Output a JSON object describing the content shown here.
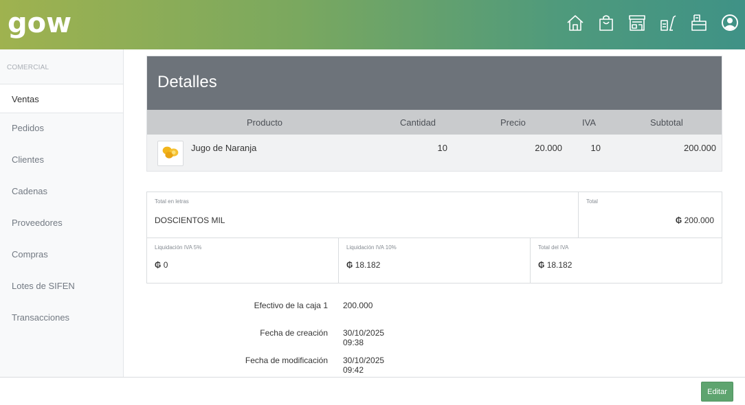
{
  "brand": {
    "logo_text": "gow"
  },
  "topbar": {
    "icons": [
      "home-icon",
      "shopping-bag-icon",
      "store-icon",
      "cart-icon",
      "inbox-icon",
      "user-icon"
    ]
  },
  "sidebar": {
    "section_title": "COMERCIAL",
    "items": [
      {
        "label": "Ventas",
        "active": true
      },
      {
        "label": "Pedidos"
      },
      {
        "label": "Clientes"
      },
      {
        "label": "Cadenas"
      },
      {
        "label": "Proveedores"
      },
      {
        "label": "Compras"
      },
      {
        "label": "Lotes de SIFEN"
      },
      {
        "label": "Transacciones"
      }
    ]
  },
  "details": {
    "title": "Detalles",
    "columns": [
      "Producto",
      "Cantidad",
      "Precio",
      "IVA",
      "Subtotal"
    ],
    "rows": [
      {
        "product": "Jugo de Naranja",
        "quantity": "10",
        "price": "20.000",
        "iva": "10",
        "subtotal": "200.000"
      }
    ]
  },
  "totals": {
    "letters_label": "Total en letras",
    "letters_value": "DOSCIENTOS MIL",
    "total_label": "Total",
    "total_value": "200.000",
    "iva5_label": "Liquidación IVA 5%",
    "iva5_value": "0",
    "iva10_label": "Liquidación IVA 10%",
    "iva10_value": "18.182",
    "iva_total_label": "Total del IVA",
    "iva_total_value": "18.182",
    "currency_symbol": "₲"
  },
  "info": [
    {
      "label": "Efectivo de la caja 1",
      "value": "200.000"
    },
    {
      "label": "Fecha de creación",
      "value": "30/10/2025 09:38"
    },
    {
      "label": "Fecha de modificación",
      "value": "30/10/2025 09:42"
    }
  ],
  "footer": {
    "edit_label": "Editar"
  },
  "colors": {
    "accent_button": "#5ea46f",
    "header_panel": "#6d737a"
  }
}
